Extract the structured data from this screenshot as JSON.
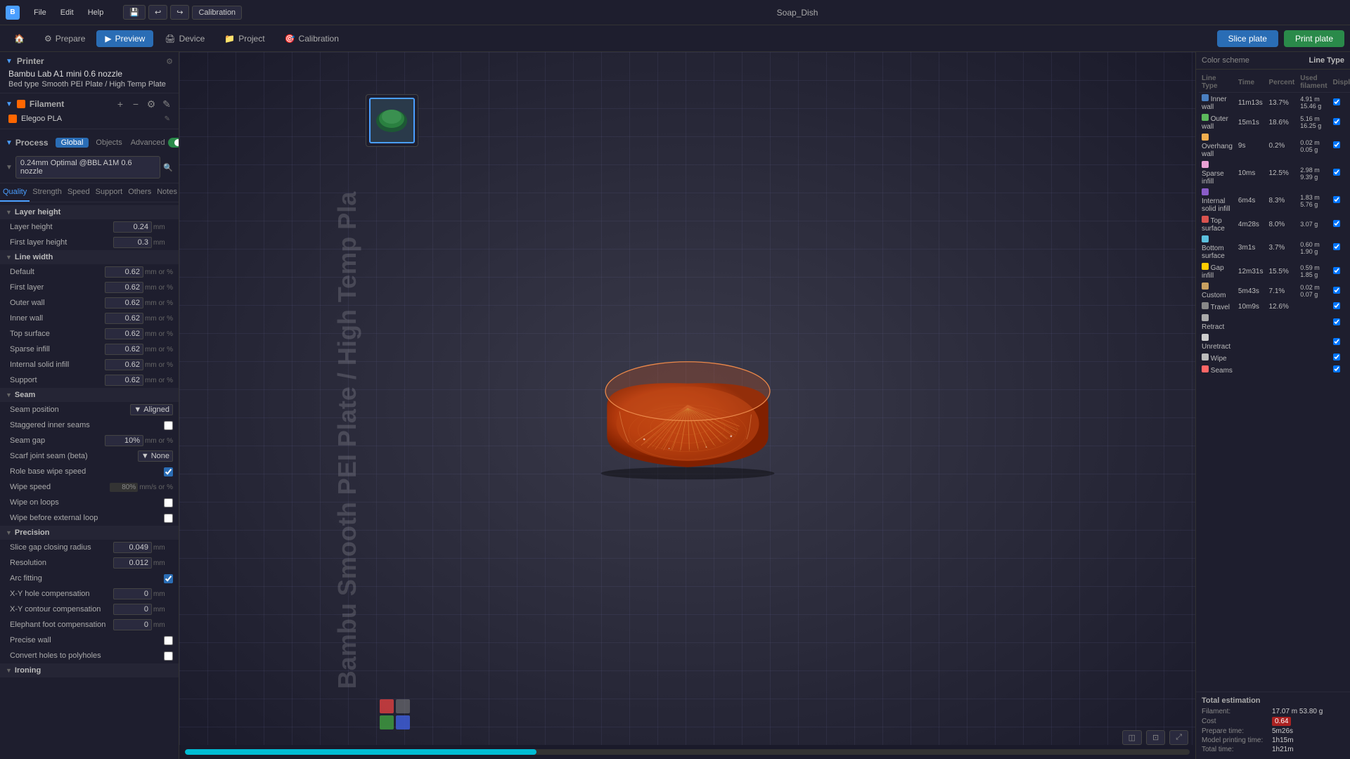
{
  "app": {
    "title": "Soap_Dish",
    "topbar_menus": [
      "File",
      "Edit",
      "Help"
    ],
    "calibration_label": "Calibration"
  },
  "navbar": {
    "home_label": "Home",
    "prepare_label": "Prepare",
    "preview_label": "Preview",
    "device_label": "Device",
    "project_label": "Project",
    "calibration_label": "Calibration",
    "slice_btn": "Slice plate",
    "print_btn": "Print plate"
  },
  "left_panel": {
    "printer_label": "Printer",
    "printer_name": "Bambu Lab A1 mini 0.6 nozzle",
    "bed_type_label": "Bed type",
    "bed_type_value": "Smooth PEI Plate / High Temp Plate",
    "filament_label": "Filament",
    "filament_name": "Elegoo PLA",
    "process_label": "Process",
    "process_tabs": [
      "Global",
      "Objects"
    ],
    "advanced_label": "Advanced",
    "process_name": "0.24mm Optimal @BBL A1M 0.6 nozzle",
    "quality_tabs": [
      "Quality",
      "Strength",
      "Speed",
      "Support",
      "Others",
      "Notes"
    ]
  },
  "settings": {
    "layer_height_group": "Layer height",
    "layer_height_label": "Layer height",
    "layer_height_value": "0.24",
    "layer_height_unit": "mm",
    "first_layer_height_label": "First layer height",
    "first_layer_height_value": "0.3",
    "first_layer_height_unit": "mm",
    "line_width_group": "Line width",
    "line_width_default_label": "Default",
    "line_width_default_value": "0.62",
    "line_width_first_layer_label": "First layer",
    "line_width_first_layer_value": "0.62",
    "line_width_outer_wall_label": "Outer wall",
    "line_width_outer_wall_value": "0.62",
    "line_width_inner_wall_label": "Inner wall",
    "line_width_inner_wall_value": "0.62",
    "line_width_top_surface_label": "Top surface",
    "line_width_top_surface_value": "0.62",
    "line_width_sparse_infill_label": "Sparse infill",
    "line_width_sparse_infill_value": "0.62",
    "line_width_internal_solid_label": "Internal solid infill",
    "line_width_internal_solid_value": "0.62",
    "line_width_support_label": "Support",
    "line_width_support_value": "0.62",
    "line_width_unit": "mm or %",
    "seam_group": "Seam",
    "seam_position_label": "Seam position",
    "seam_position_value": "Aligned",
    "staggered_inner_seams_label": "Staggered inner seams",
    "seam_gap_label": "Seam gap",
    "seam_gap_value": "10%",
    "seam_gap_unit": "mm or %",
    "scarf_joint_label": "Scarf joint seam (beta)",
    "scarf_joint_value": "None",
    "role_base_wipe_label": "Role base wipe speed",
    "wipe_speed_label": "Wipe speed",
    "wipe_speed_value": "80%",
    "wipe_on_loops_label": "Wipe on loops",
    "wipe_before_ext_label": "Wipe before external loop",
    "precision_group": "Precision",
    "slice_gap_label": "Slice gap closing radius",
    "slice_gap_value": "0.049",
    "slice_gap_unit": "mm",
    "resolution_label": "Resolution",
    "resolution_value": "0.012",
    "resolution_unit": "mm",
    "arc_fitting_label": "Arc fitting",
    "xy_hole_label": "X-Y hole compensation",
    "xy_hole_value": "0",
    "xy_hole_unit": "mm",
    "xy_contour_label": "X-Y contour compensation",
    "xy_contour_value": "0",
    "xy_contour_unit": "mm",
    "elephant_foot_label": "Elephant foot compensation",
    "elephant_foot_value": "0",
    "elephant_foot_unit": "mm",
    "precise_wall_label": "Precise wall",
    "convert_holes_label": "Convert holes to polyholes",
    "ironing_group": "Ironing"
  },
  "right_panel": {
    "color_scheme_label": "Color scheme",
    "line_type_label": "Line Type",
    "columns": [
      "Line Type",
      "Time",
      "Percent",
      "Used filament",
      "Display"
    ],
    "line_types": [
      {
        "name": "Inner wall",
        "color": "#4a7fc1",
        "time": "11m13s",
        "percent": "13.7%",
        "filament": "4.91 m  15.46 g"
      },
      {
        "name": "Outer wall",
        "color": "#5cb85c",
        "time": "15m1s",
        "percent": "18.6%",
        "filament": "5.16 m  16.25 g"
      },
      {
        "name": "Overhang wall",
        "color": "#f0ad4e",
        "time": "9s",
        "percent": "0.2%",
        "filament": "0.02 m  0.05 g"
      },
      {
        "name": "Sparse infill",
        "color": "#e8a0d4",
        "time": "10ms",
        "percent": "12.5%",
        "filament": "2.98 m  9.39 g"
      },
      {
        "name": "Internal solid infill",
        "color": "#8a5cc8",
        "time": "6m4s",
        "percent": "8.3%",
        "filament": "1.83 m  5.76 g"
      },
      {
        "name": "Top surface",
        "color": "#d9534f",
        "time": "4m28s",
        "percent": "8.0%",
        "filament": "3.07 g"
      },
      {
        "name": "Bottom surface",
        "color": "#5bc0de",
        "time": "3m1s",
        "percent": "3.7%",
        "filament": "0.60 m  1.90 g"
      },
      {
        "name": "Gap infill",
        "color": "#ffcc00",
        "time": "12m31s",
        "percent": "15.5%",
        "filament": "0.59 m  1.85 g"
      },
      {
        "name": "Custom",
        "color": "#c8a060",
        "time": "5m43s",
        "percent": "7.1%",
        "filament": "0.02 m  0.07 g"
      },
      {
        "name": "Travel",
        "color": "#888888",
        "time": "10m9s",
        "percent": "12.6%",
        "filament": ""
      },
      {
        "name": "Retract",
        "color": "#aaaaaa",
        "time": "",
        "percent": "",
        "filament": ""
      },
      {
        "name": "Unretract",
        "color": "#cccccc",
        "time": "",
        "percent": "",
        "filament": ""
      },
      {
        "name": "Wipe",
        "color": "#bbbbbb",
        "time": "",
        "percent": "",
        "filament": ""
      },
      {
        "name": "Seams",
        "color": "#ff6666",
        "time": "",
        "percent": "",
        "filament": ""
      }
    ],
    "estimation": {
      "title": "Total estimation",
      "filament_label": "Filament:",
      "filament_value": "17.07 m  53.80 g",
      "cost_label": "Cost",
      "cost_value": "0.64",
      "prepare_label": "Prepare time:",
      "prepare_value": "5m26s",
      "model_label": "Model printing time:",
      "model_value": "1h15m",
      "total_label": "Total time:",
      "total_value": "1h21m"
    }
  },
  "viewport": {
    "watermark_lines": [
      "Bambu Smooth PEI Plate / High Temp Pla"
    ],
    "progress_percent": 35,
    "model_color": "#c0521a"
  }
}
